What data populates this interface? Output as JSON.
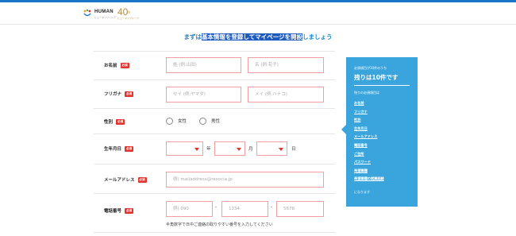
{
  "header": {
    "logo_text": "HUMAN",
    "logo_sub": "ヒューマンリソシア",
    "anniversary_number": "40",
    "anniversary_suffix": "th",
    "anniversary_text": "ヒューマングループ",
    "bar_color": "#1a74c9"
  },
  "intro": {
    "before": "まずは",
    "highlight": "基本情報を登録してマイページを開設",
    "after": "しましょう"
  },
  "required_badge": "必須",
  "form": {
    "name": {
      "label": "お名前",
      "last_placeholder": "姓 (例:山田)",
      "first_placeholder": "名 (例:花子)"
    },
    "furigana": {
      "label": "フリガナ",
      "last_placeholder": "セイ (例:ヤマダ)",
      "first_placeholder": "メイ (例:ハナコ)"
    },
    "gender": {
      "label": "性別",
      "female": "女性",
      "male": "男性"
    },
    "birthdate": {
      "label": "生年月日",
      "year_unit": "年",
      "month_unit": "月",
      "day_unit": "日"
    },
    "email": {
      "label": "メールアドレス",
      "placeholder": "例) mailaddress@resocia.jp"
    },
    "phone": {
      "label": "電話番号",
      "part1_placeholder": "例) 090",
      "part2_placeholder": "1234",
      "part3_placeholder": "5678",
      "separator": "-",
      "hint": "半角数字で日中ご連絡の取りやすい番号を入力してください"
    }
  },
  "sidebar": {
    "header": "必須項目が10件のうち",
    "count_text": "残りは10件です",
    "subheader": "残りの必須項目は",
    "items": [
      "お名前",
      "フリガナ",
      "性別",
      "生年月日",
      "メールアドレス",
      "電話番号",
      "ご住所",
      "パスワード",
      "希望職種",
      "希望職種の就業経験"
    ],
    "footer": "になります",
    "bg_color": "#3aa5dc"
  },
  "colors": {
    "accent": "#1e88c8",
    "required": "#e0352e",
    "input_border": "#f0a0a0"
  }
}
